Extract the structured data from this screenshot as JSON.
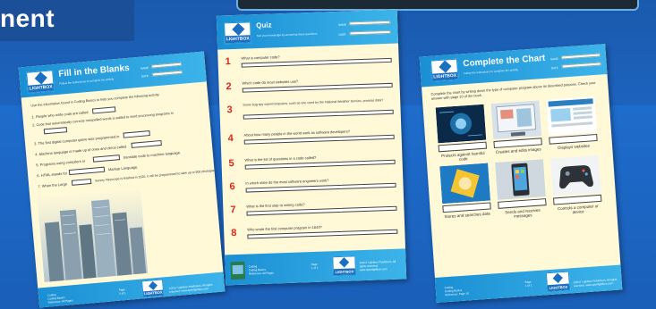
{
  "page": {
    "heading": "nent"
  },
  "brand": {
    "logo_text": "LIGHTBOX"
  },
  "fill_sheet": {
    "title": "Fill in the Blanks",
    "subtitle": "Follow the instructions to complete the activity",
    "name_label": "NAME",
    "date_label": "DATE",
    "instruction": "Use the information found in Coding Basics to help you complete the following activity.",
    "items": [
      "1. People who write code are called",
      "2. Code that automatically corrects misspelled words is added to word processing programs in",
      "3. The first digital computer game was programmed in",
      "4. Machine language is made up of ones and zeros called",
      "5. Programs using compilers or",
      "translate code to machine language.",
      "6. HTML stands for",
      "Markup Language.",
      "7. When the Large",
      "Survey Telescope is finished in 2020, it will be programmed to take up to 800 photographs per day."
    ],
    "footer": {
      "series": "Coding",
      "book": "Coding Basics",
      "reference": "Reference: All Pages",
      "page_label": "Page",
      "page_value": "1 of 1",
      "copyright": "©2017 Lightbox Publishers. All rights reserved. www.openlightbox.com"
    }
  },
  "quiz_sheet": {
    "title": "Quiz",
    "subtitle": "Test your knowledge by answering these questions.",
    "name_label": "NAME",
    "date_label": "DATE",
    "questions": [
      {
        "num": "1",
        "text": "What is computer code?"
      },
      {
        "num": "2",
        "text": "Which code do most websites use?"
      },
      {
        "num": "3",
        "text": "Some bug spy supercomputers, such as one used by the National Weather Service, process data?"
      },
      {
        "num": "4",
        "text": "About how many people in the world work as software developers?"
      },
      {
        "num": "5",
        "text": "What is the list of questions in a code called?"
      },
      {
        "num": "6",
        "text": "In which state do the most software engineers work?"
      },
      {
        "num": "7",
        "text": "What is the first step to writing code?"
      },
      {
        "num": "8",
        "text": "Who wrote the first computer program in 1843?"
      }
    ],
    "footer": {
      "series": "Coding",
      "book": "Coding Basics",
      "reference": "Reference: All Pages",
      "page_label": "Page",
      "page_value": "1 of 1",
      "copyright": "©2017 Lightbox Publishers. All rights reserved. www.openlightbox.com"
    }
  },
  "chart_sheet": {
    "title": "Complete the Chart",
    "subtitle": "Follow the instructions to complete the activity",
    "name_label": "NAME",
    "date_label": "DATE",
    "instruction": "Complete the chart by writing down the type of computer program above its described purpose. Check your answer with page 10 of the book.",
    "captions": [
      "Protects against harmful code",
      "Creates and edits images",
      "Displays websites",
      "Stores and searches data",
      "Sends and receives messages",
      "Controls a computer or device"
    ],
    "footer": {
      "series": "Coding",
      "book": "Coding Basics",
      "reference": "Reference: Page 10",
      "page_label": "Page",
      "page_value": "1 of 1",
      "copyright": "©2017 Lightbox Publishers. All rights reserved. www.openlightbox.com"
    }
  },
  "colors": {
    "background": "#1e5fb4",
    "sheet_header": "#1a8fd4",
    "paper": "#fff9d8",
    "question_number": "#d9261c"
  }
}
